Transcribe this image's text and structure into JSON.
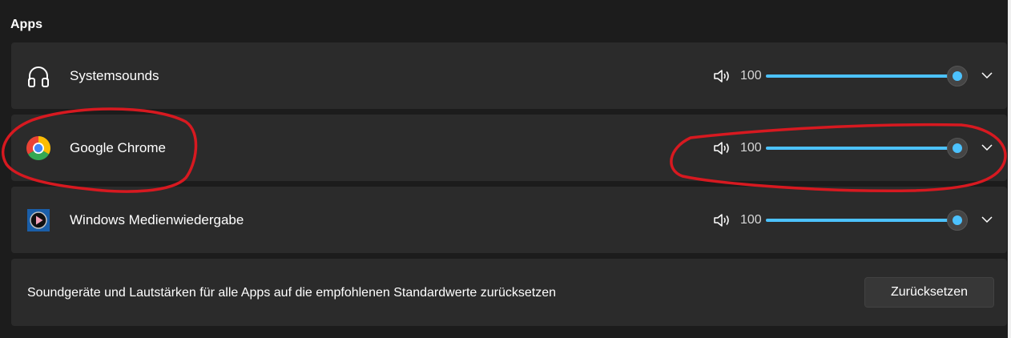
{
  "section": {
    "title": "Apps"
  },
  "apps": [
    {
      "name": "Systemsounds",
      "icon": "headphones-icon",
      "volume": "100",
      "level": 1.0
    },
    {
      "name": "Google Chrome",
      "icon": "chrome-icon",
      "volume": "100",
      "level": 1.0
    },
    {
      "name": "Windows Medienwiedergabe",
      "icon": "media-player-icon",
      "volume": "100",
      "level": 1.0
    }
  ],
  "reset": {
    "text": "Soundgeräte und Lautstärken für alle Apps auf die empfohlenen Standardwerte zurücksetzen",
    "button_label": "Zurücksetzen"
  },
  "colors": {
    "accent": "#4cc2ff",
    "card": "#2b2b2b",
    "background": "#1c1c1c",
    "annotation": "#d71920"
  }
}
